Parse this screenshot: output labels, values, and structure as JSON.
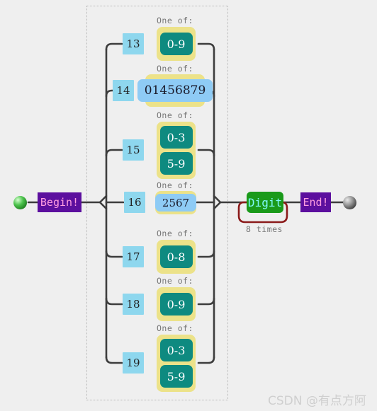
{
  "diagram": {
    "title": "regex railroad diagram",
    "background_color": "#efefef",
    "line_color": "#3d3d3d",
    "loop_color": "#8b1a1a",
    "caption_text": "One of:",
    "begin_label": "Begin!",
    "end_label": "End!",
    "reference_label": "Digit",
    "loop_label": "8 times",
    "start_dot": "start-dot-green",
    "end_dot": "end-dot-black"
  },
  "branches": [
    {
      "number": "13",
      "caption": "One of:",
      "kind": "range",
      "items": [
        "0-9"
      ]
    },
    {
      "number": "14",
      "caption": "One of:",
      "kind": "literal",
      "items": [
        "01456879"
      ]
    },
    {
      "number": "15",
      "caption": "One of:",
      "kind": "range",
      "items": [
        "0-3",
        "5-9"
      ]
    },
    {
      "number": "16",
      "caption": "One of:",
      "kind": "literal",
      "items": [
        "2567"
      ]
    },
    {
      "number": "17",
      "caption": "One of:",
      "kind": "range",
      "items": [
        "0-8"
      ]
    },
    {
      "number": "18",
      "caption": "One of:",
      "kind": "range",
      "items": [
        "0-9"
      ]
    },
    {
      "number": "19",
      "caption": "One of:",
      "kind": "range",
      "items": [
        "0-3",
        "5-9"
      ]
    }
  ],
  "watermark": {
    "text": "CSDN @有点方阿"
  }
}
